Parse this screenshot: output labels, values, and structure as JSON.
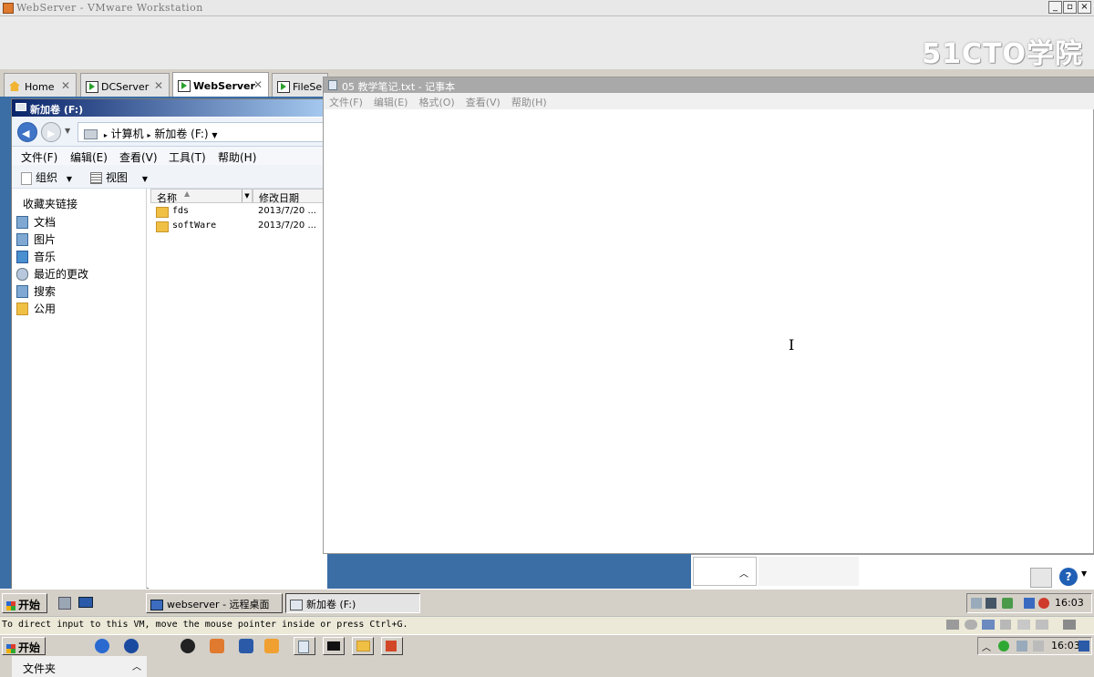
{
  "vmware": {
    "title": "WebServer - VMware Workstation",
    "watermark": "51CTO学院",
    "window_buttons": [
      "_",
      "▫",
      "×"
    ],
    "tabs": [
      {
        "label": "Home",
        "close": "✕"
      },
      {
        "label": "DCServer",
        "close": "✕"
      },
      {
        "label": "WebServer",
        "close": "✕"
      },
      {
        "label": "FileSer"
      }
    ],
    "status_message": "To direct input to this VM, move the mouse pointer inside or press Ctrl+G."
  },
  "explorer": {
    "title": "新加卷 (F:)",
    "breadcrumb": [
      "计算机",
      "新加卷 (F:)"
    ],
    "breadcrumb_sep": "▸",
    "menu": [
      "文件(F)",
      "编辑(E)",
      "查看(V)",
      "工具(T)",
      "帮助(H)"
    ],
    "toolbar": {
      "organize": "组织",
      "views": "视图"
    },
    "favorites_header": "收藏夹链接",
    "nav_items": [
      "文档",
      "图片",
      "音乐",
      "最近的更改",
      "搜索",
      "公用"
    ],
    "folders_label": "文件夹",
    "columns": {
      "name": "名称",
      "date": "修改日期"
    },
    "files": [
      {
        "name": "fds",
        "date": "2013/7/20 ..."
      },
      {
        "name": "softWare",
        "date": "2013/7/20 ..."
      }
    ]
  },
  "notepad": {
    "title": "05 教学笔记.txt - 记事本",
    "menu": [
      "文件(F)",
      "编辑(E)",
      "格式(O)",
      "查看(V)",
      "帮助(H)"
    ],
    "cursor": "I"
  },
  "guest_taskbar": {
    "start": "开始",
    "tasks": [
      "webserver - 远程桌面",
      "新加卷 (F:)"
    ],
    "clock": "16:03"
  },
  "host_taskbar": {
    "start": "开始",
    "clock": "16:03"
  },
  "colors": {
    "desktop": "#3a6ea5",
    "title_active": "#0a246a",
    "notepad_title_inactive": "#a9a9a9"
  }
}
